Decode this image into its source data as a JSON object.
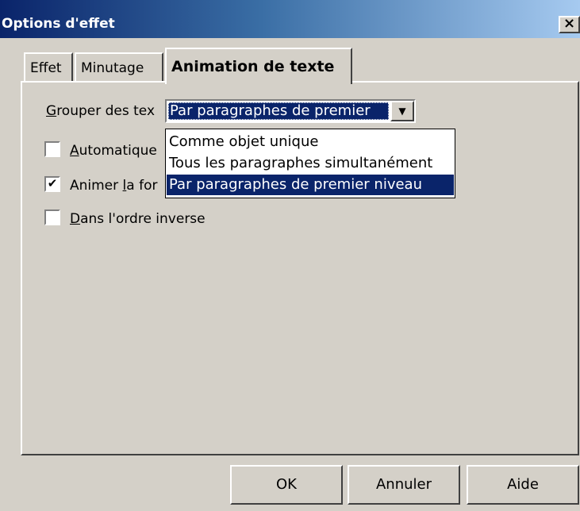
{
  "window": {
    "title": "Options d'effet",
    "close": "×"
  },
  "tabs": [
    {
      "label": "Effet",
      "active": false
    },
    {
      "label": "Minutage",
      "active": false
    },
    {
      "label": "Animation de texte",
      "active": true
    }
  ],
  "group_text": {
    "label_mnemonic": "G",
    "label_rest": "rouper des tex",
    "selected": "Par paragraphes de premier",
    "options": [
      "Comme objet unique",
      "Tous les paragraphes simultanément",
      "Par paragraphes de premier niveau"
    ]
  },
  "checkboxes": {
    "auto": {
      "mnemonic": "A",
      "rest": "utomatique",
      "checked": false
    },
    "animate_shape": {
      "before": "Animer ",
      "mnemonic": "l",
      "rest": "a for",
      "checked": true,
      "mark": "✔"
    },
    "reverse": {
      "mnemonic": "D",
      "rest": "ans l'ordre inverse",
      "checked": false
    }
  },
  "buttons": {
    "ok": "OK",
    "cancel": "Annuler",
    "help": "Aide"
  }
}
